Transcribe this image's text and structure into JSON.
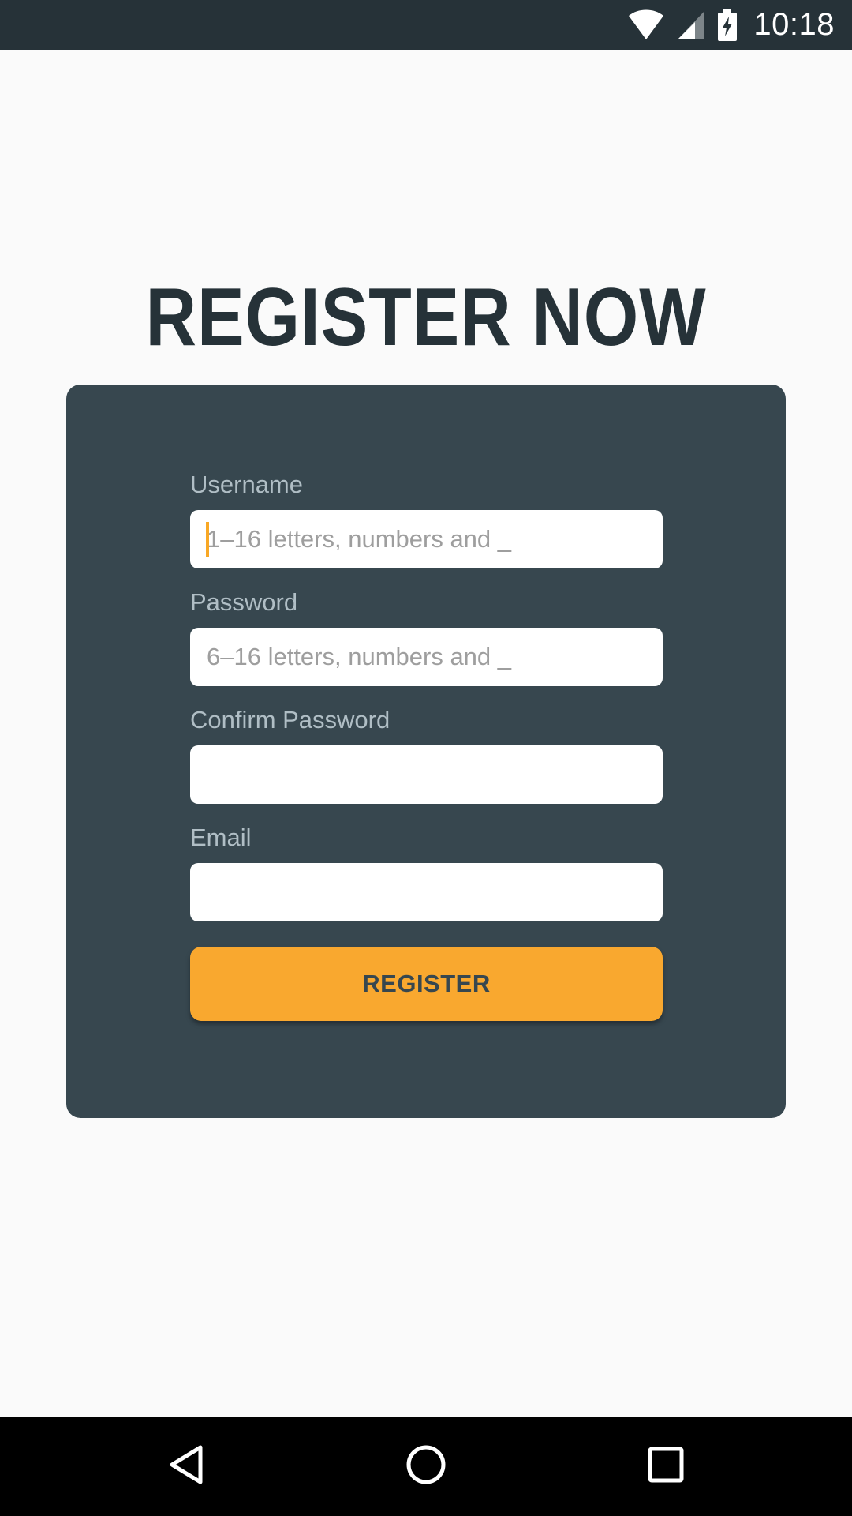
{
  "status_bar": {
    "time": "10:18",
    "icons": [
      "wifi-icon",
      "cell-signal-icon",
      "battery-charging-icon"
    ]
  },
  "page": {
    "title": "REGISTER NOW"
  },
  "form": {
    "fields": [
      {
        "label": "Username",
        "value": "",
        "placeholder": "1–16 letters, numbers and _",
        "focused": true
      },
      {
        "label": "Password",
        "value": "",
        "placeholder": "6–16 letters, numbers and _",
        "focused": false
      },
      {
        "label": "Confirm Password",
        "value": "",
        "placeholder": "",
        "focused": false
      },
      {
        "label": "Email",
        "value": "",
        "placeholder": "",
        "focused": false
      }
    ],
    "submit_label": "REGISTER"
  },
  "nav_bar": {
    "icons": [
      "back-icon",
      "home-icon",
      "recents-icon"
    ]
  },
  "colors": {
    "status_bar": "#263238",
    "background": "#fafafa",
    "card": "#37474f",
    "accent": "#f9a825",
    "title": "#263238"
  }
}
